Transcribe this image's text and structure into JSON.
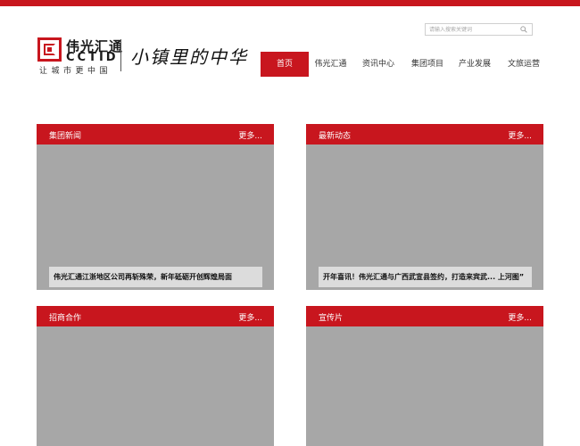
{
  "header": {
    "logo": {
      "name_cn": "伟光汇通",
      "name_en": "CCTID",
      "slogan": "让城市更中国",
      "calligraphy": "小镇里的中华"
    },
    "search": {
      "placeholder": "请输入搜索关键词",
      "value": ""
    },
    "nav": [
      {
        "label": "首页",
        "active": true
      },
      {
        "label": "伟光汇通",
        "active": false
      },
      {
        "label": "资讯中心",
        "active": false
      },
      {
        "label": "集团项目",
        "active": false
      },
      {
        "label": "产业发展",
        "active": false
      },
      {
        "label": "文旅运营",
        "active": false
      }
    ]
  },
  "panels": [
    {
      "title": "集团新闻",
      "more": "更多...",
      "caption": "伟光汇通江浙地区公司再斩殊荣，新年砥砺开创辉煌局面"
    },
    {
      "title": "最新动态",
      "more": "更多...",
      "caption": "开年喜讯！伟光汇通与广西武宣县签约，打造来宾武... 上河图”"
    },
    {
      "title": "招商合作",
      "more": "更多...",
      "caption": ""
    },
    {
      "title": "宣传片",
      "more": "更多...",
      "caption": ""
    }
  ],
  "colors": {
    "brand_red": "#c8161e",
    "panel_gray": "#a7a7a7",
    "caption_bg": "#dcdcdc"
  },
  "icons": {
    "search": "magnifier-icon"
  }
}
